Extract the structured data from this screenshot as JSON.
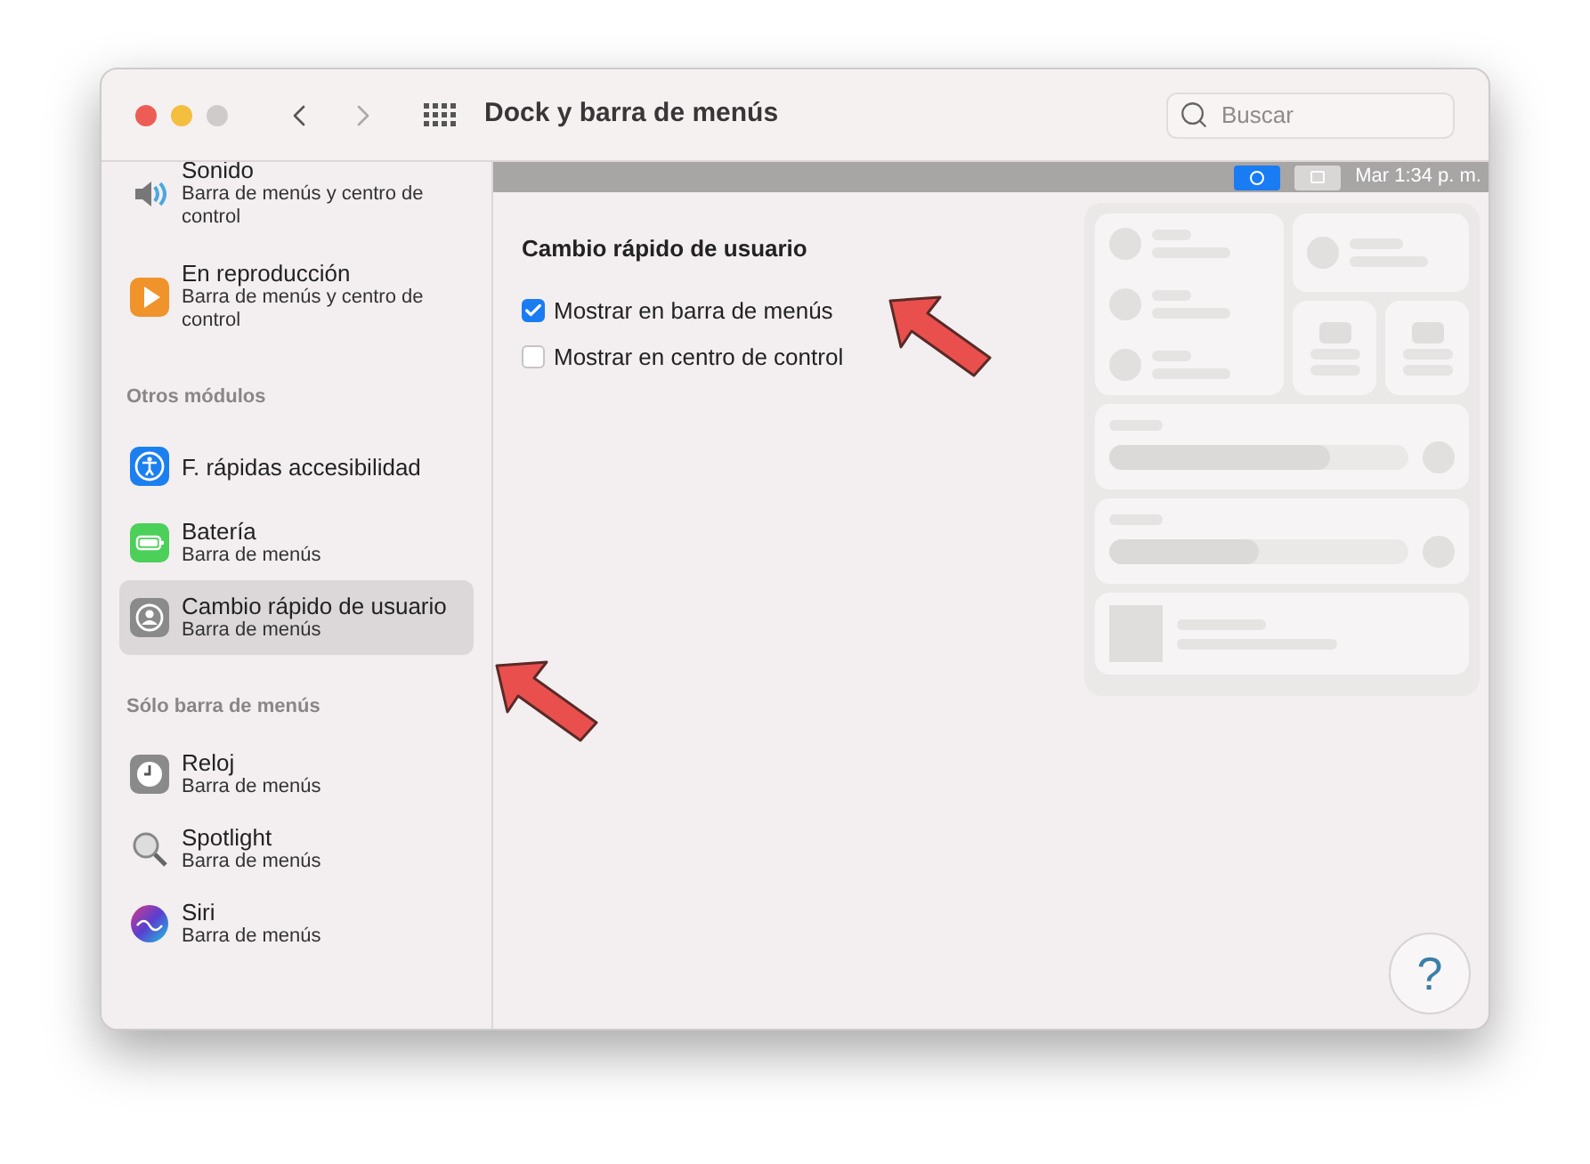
{
  "window": {
    "title": "Dock y barra de menús"
  },
  "search": {
    "placeholder": "Buscar"
  },
  "sidebar": {
    "items": [
      {
        "kind": "item",
        "title": "Sonido",
        "subtitle": "Barra de menús y centro de control",
        "selected": false
      },
      {
        "kind": "item",
        "title": "En reproducción",
        "subtitle": "Barra de menús y centro de control",
        "selected": false
      },
      {
        "kind": "section",
        "title": "Otros módulos"
      },
      {
        "kind": "item",
        "title": "F. rápidas accesibilidad",
        "selected": false
      },
      {
        "kind": "item",
        "title": "Batería",
        "subtitle": "Barra de menús",
        "selected": false
      },
      {
        "kind": "item",
        "title": "Cambio rápido de usuario",
        "subtitle": "Barra de menús",
        "selected": true
      },
      {
        "kind": "section",
        "title": "Sólo barra de menús"
      },
      {
        "kind": "item",
        "title": "Reloj",
        "subtitle": "Barra de menús",
        "selected": false
      },
      {
        "kind": "item",
        "title": "Spotlight",
        "subtitle": "Barra de menús",
        "selected": false
      },
      {
        "kind": "item",
        "title": "Siri",
        "subtitle": "Barra de menús",
        "selected": false
      }
    ]
  },
  "menu_bar_preview": {
    "clock": "Mar 1:34 p. m."
  },
  "panel": {
    "title": "Cambio rápido de usuario",
    "options": [
      {
        "label": "Mostrar en barra de menús",
        "checked": true
      },
      {
        "label": "Mostrar en centro de control",
        "checked": false
      }
    ]
  },
  "help_button": {
    "label": "?"
  }
}
